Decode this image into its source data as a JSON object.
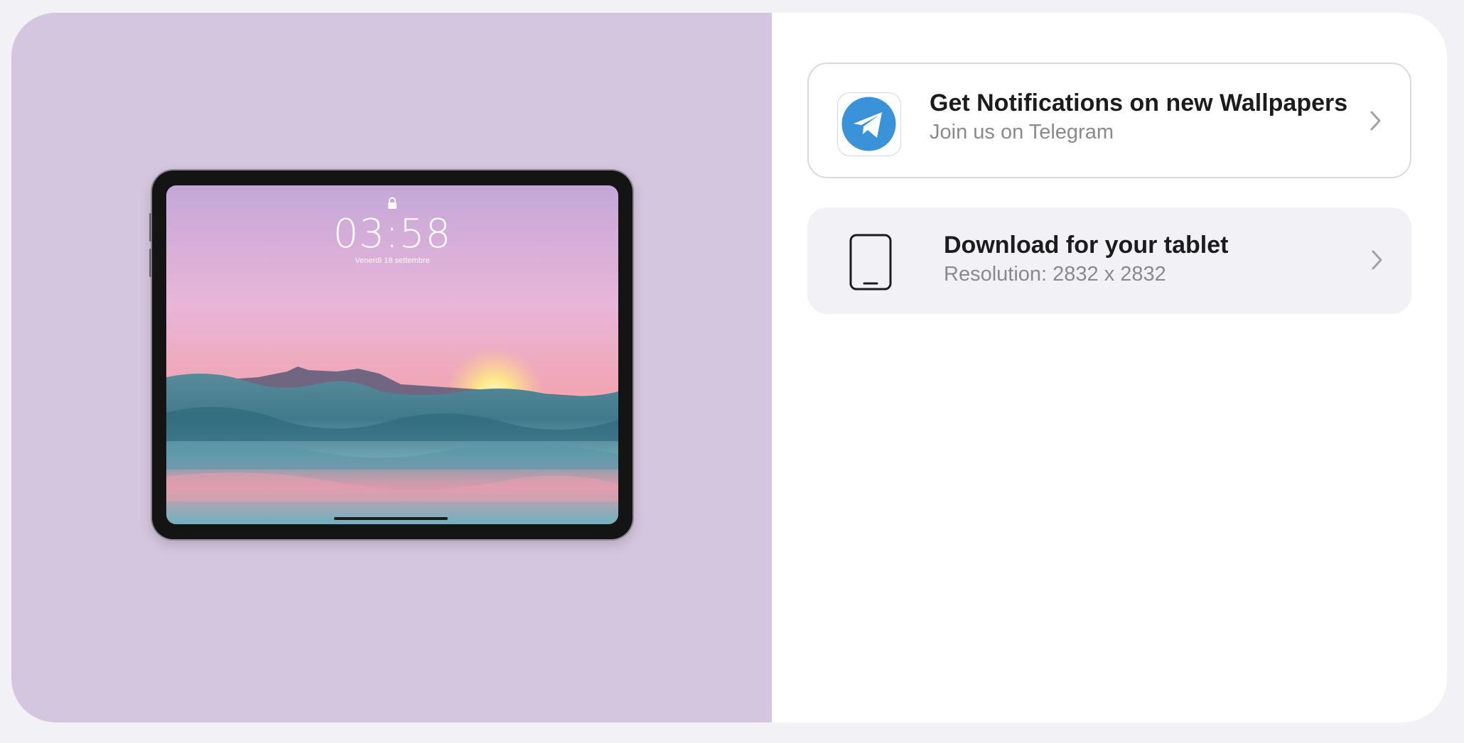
{
  "preview": {
    "device": "tablet",
    "lock_screen": {
      "time": "03:58",
      "date": "Venerdì 18 settembre"
    }
  },
  "options": {
    "telegram": {
      "title": "Get Notifications on new Wallpapers",
      "subtitle": "Join us on Telegram",
      "icon": "telegram-icon",
      "accent": "#3a93d8"
    },
    "download": {
      "title": "Download for your tablet",
      "subtitle": "Resolution: 2832 x 2832",
      "icon": "tablet-icon"
    }
  },
  "colors": {
    "page_bg": "#f2f1f6",
    "preview_bg": "#d4c6de",
    "card_bg": "#ffffff",
    "muted_text": "#8a8a8e",
    "chevron": "#a0a0a6"
  }
}
